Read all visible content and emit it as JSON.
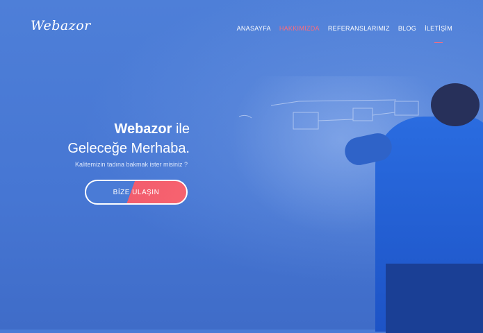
{
  "brand": {
    "logo": "Webazor"
  },
  "nav": {
    "items": [
      {
        "label": "ANASAYFA"
      },
      {
        "label": "HAKKIMIZDA"
      },
      {
        "label": "REFERANSLARIMIZ"
      },
      {
        "label": "BLOG"
      },
      {
        "label": "İLETİŞİM"
      }
    ]
  },
  "hero": {
    "brand_word": "Webazor",
    "title_rest": " ile",
    "title_line2": "Geleceğe Merhaba.",
    "subtitle": "Kalitemizin tadına bakmak ister misiniz ?",
    "cta_label": "BİZE ULAŞIN"
  },
  "colors": {
    "primary": "#4a7bd6",
    "accent": "#f25d6e"
  }
}
